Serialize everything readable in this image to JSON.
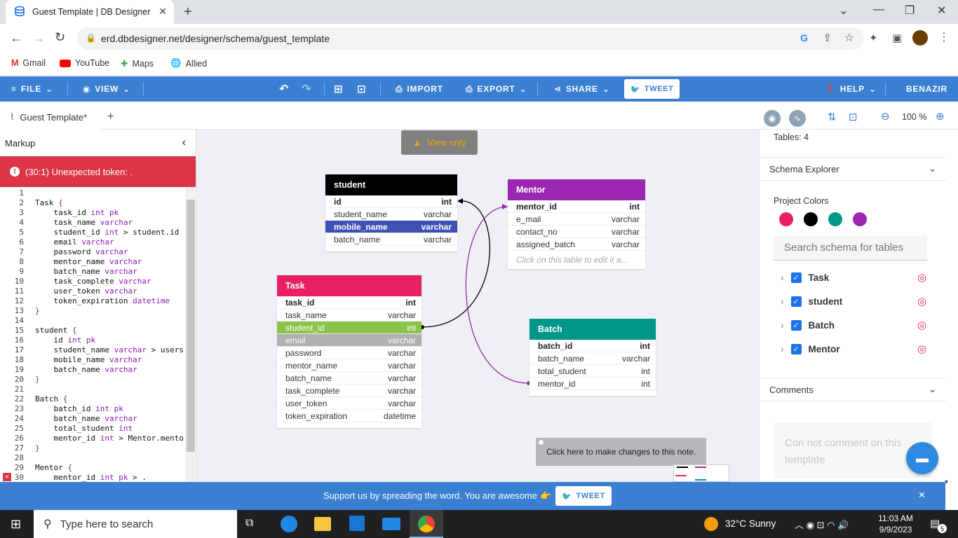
{
  "browser": {
    "tab_title": "Guest Template | DB Designer",
    "url": "erd.dbdesigner.net/designer/schema/guest_template",
    "bookmarks": [
      "Gmail",
      "YouTube",
      "Maps",
      "Allied"
    ]
  },
  "toolbar": {
    "file": "FILE",
    "view": "VIEW",
    "import": "IMPORT",
    "export": "EXPORT",
    "share": "SHARE",
    "tweet": "TWEET",
    "help": "HELP",
    "user": "BENAZIR"
  },
  "doc_tab": "Guest Template*",
  "zoom": "100 %",
  "markup": {
    "title": "Markup",
    "error": "(30:1) Unexpected token: .",
    "lines": [
      "",
      "Task {",
      "    task_id int pk",
      "    task_name varchar",
      "    student_id int > student.id",
      "    email varchar",
      "    password varchar",
      "    mentor_name varchar",
      "    batch_name varchar",
      "    task_complete varchar",
      "    user_token varchar",
      "    token_expiration datetime",
      "}",
      "",
      "student {",
      "    id int pk",
      "    student_name varchar > users",
      "    mobile_name varchar",
      "    batch_name varchar",
      "}",
      "",
      "Batch {",
      "    batch_id int pk",
      "    batch_name varchar",
      "    total_student int",
      "    mentor_id int > Mentor.mento",
      "}",
      "",
      "Mentor {",
      "    mentor_id int pk > ."
    ]
  },
  "canvas": {
    "view_only": "View only",
    "note": "Click here to make changes to this note.",
    "tables": {
      "student": {
        "name": "student",
        "color": "#000000",
        "fields": [
          [
            "id",
            "int"
          ],
          [
            "student_name",
            "varchar"
          ],
          [
            "mobile_name",
            "varchar"
          ],
          [
            "batch_name",
            "varchar"
          ]
        ]
      },
      "mentor": {
        "name": "Mentor",
        "color": "#9c27b0",
        "fields": [
          [
            "mentor_id",
            "int"
          ],
          [
            "e_mail",
            "varchar"
          ],
          [
            "contact_no",
            "varchar"
          ],
          [
            "assigned_batch",
            "varchar"
          ]
        ],
        "hint": "Click on this table to edit it a..."
      },
      "task": {
        "name": "Task",
        "color": "#e91e63",
        "fields": [
          [
            "task_id",
            "int"
          ],
          [
            "task_name",
            "varchar"
          ],
          [
            "student_id",
            "int"
          ],
          [
            "email",
            "varchar"
          ],
          [
            "password",
            "varchar"
          ],
          [
            "mentor_name",
            "varchar"
          ],
          [
            "batch_name",
            "varchar"
          ],
          [
            "task_complete",
            "varchar"
          ],
          [
            "user_token",
            "varchar"
          ],
          [
            "token_expiration",
            "datetime"
          ]
        ]
      },
      "batch": {
        "name": "Batch",
        "color": "#009688",
        "fields": [
          [
            "batch_id",
            "int"
          ],
          [
            "batch_name",
            "varchar"
          ],
          [
            "total_student",
            "int"
          ],
          [
            "mentor_id",
            "int"
          ]
        ]
      }
    }
  },
  "right_panel": {
    "tables_count": "Tables:  4",
    "schema_explorer": "Schema Explorer",
    "project_colors_label": "Project Colors",
    "colors": [
      "#e91e63",
      "#000000",
      "#009688",
      "#9c27b0"
    ],
    "search_placeholder": "Search schema for tables",
    "items": [
      "Task",
      "student",
      "Batch",
      "Mentor"
    ],
    "comments": "Comments",
    "comment_placeholder": "Con not comment on this template"
  },
  "banner": {
    "text": "Support us by spreading the word. You are awesome",
    "tweet": "TWEET"
  },
  "taskbar": {
    "search": "Type here to search",
    "weather": "32°C  Sunny",
    "time": "11:03 AM",
    "date": "9/9/2023",
    "notifications": "5"
  }
}
